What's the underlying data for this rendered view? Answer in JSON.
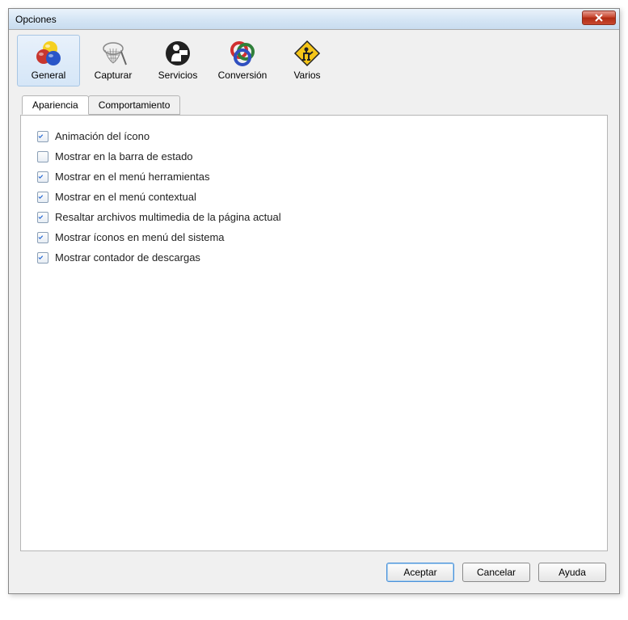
{
  "window": {
    "title": "Opciones"
  },
  "toolbar": {
    "items": [
      {
        "label": "General",
        "icon": "balls-icon",
        "active": true
      },
      {
        "label": "Capturar",
        "icon": "net-icon",
        "active": false
      },
      {
        "label": "Servicios",
        "icon": "services-icon",
        "active": false
      },
      {
        "label": "Conversión",
        "icon": "rings-icon",
        "active": false
      },
      {
        "label": "Varios",
        "icon": "construction-icon",
        "active": false
      }
    ]
  },
  "tabs": {
    "items": [
      {
        "label": "Apariencia",
        "active": true
      },
      {
        "label": "Comportamiento",
        "active": false
      }
    ]
  },
  "checkboxes": [
    {
      "label": "Animación del ícono",
      "checked": true
    },
    {
      "label": "Mostrar en la barra de estado",
      "checked": false
    },
    {
      "label": "Mostrar en el menú herramientas",
      "checked": true
    },
    {
      "label": "Mostrar en el menú contextual",
      "checked": true
    },
    {
      "label": "Resaltar archivos multimedia de la página actual",
      "checked": true
    },
    {
      "label": "Mostrar íconos en menú del sistema",
      "checked": true
    },
    {
      "label": "Mostrar contador de descargas",
      "checked": true
    }
  ],
  "buttons": {
    "accept": "Aceptar",
    "cancel": "Cancelar",
    "help": "Ayuda"
  }
}
